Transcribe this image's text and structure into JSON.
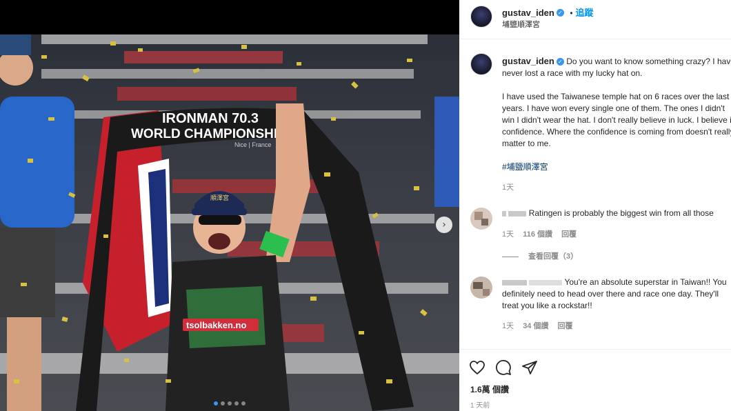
{
  "post": {
    "username": "gustav_iden",
    "follow_label": "追蹤",
    "separator": "•",
    "location": "埔鹽順澤宮"
  },
  "photo": {
    "banner_text": "IRONMAN 70.3 WORLD CHAMPIONSHIP",
    "banner_sub": "Nice | France",
    "hat_text": "順澤宮",
    "jersey_text": "tsolbakken.no",
    "dots_count": 5
  },
  "caption": {
    "username": "gustav_iden",
    "text": "Do you want to know something crazy? I have never lost a race with my lucky hat on.\n\nI have used the Taiwanese temple hat on 6 races over the last 2 years. I have won every single one of them. The ones I didn't win I didn't wear the hat. I don't really believe in luck. I believe in confidence. Where the confidence is coming from doesn't really matter to me.",
    "hashtag": "#埔鹽順澤宮",
    "time": "1天"
  },
  "comments": [
    {
      "text": "Ratingen is probably the biggest win from all those",
      "time": "1天",
      "likes": "116 個讚",
      "reply_label": "回覆",
      "view_replies": "查看回覆（3）"
    },
    {
      "text": "You're an absolute superstar in Taiwan!! You definitely need to head over there and race one day. They'll treat you like a rockstar!!",
      "time": "1天",
      "likes": "34 個讚",
      "reply_label": "回覆"
    }
  ],
  "actions": {
    "likes_count": "1.6萬 個讚",
    "posted": "1 天前",
    "icons": [
      "heart-icon",
      "comment-icon",
      "share-icon"
    ]
  },
  "colors": {
    "link_blue": "#0095f6",
    "verified_blue": "#3897f0",
    "hashtag_blue": "#00376b",
    "meta_gray": "#8e8e8e"
  }
}
